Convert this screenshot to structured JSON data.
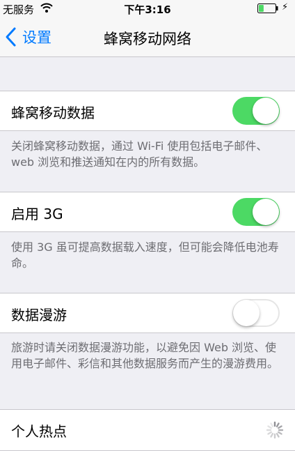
{
  "status_bar": {
    "carrier": "无服务",
    "time": "下午3:16",
    "wifi_icon": "wifi-icon",
    "battery_icon": "battery-icon",
    "charging_icon": "charging-bolt-icon",
    "battery_level": 0.3,
    "battery_color": "#4cd964"
  },
  "nav": {
    "back_label": "设置",
    "title": "蜂窝移动网络",
    "accent_color": "#007aff"
  },
  "settings": [
    {
      "label": "蜂窝移动数据",
      "toggle_on": true,
      "footer": "关闭蜂窝移动数据，通过 Wi-Fi 使用包括电子邮件、web 浏览和推送通知在内的所有数据。"
    },
    {
      "label": "启用 3G",
      "toggle_on": true,
      "footer": "使用 3G 虽可提高数据载入速度，但可能会降低电池寿命。"
    },
    {
      "label": "数据漫游",
      "toggle_on": false,
      "footer": "旅游时请关闭数据漫游功能，以避免因 Web 浏览、使用电子邮件、彩信和其他数据服务而产生的漫游费用。"
    },
    {
      "label": "个人热点",
      "status_icon": "loading-spinner-icon"
    }
  ],
  "toggle_on_color": "#4cd964"
}
